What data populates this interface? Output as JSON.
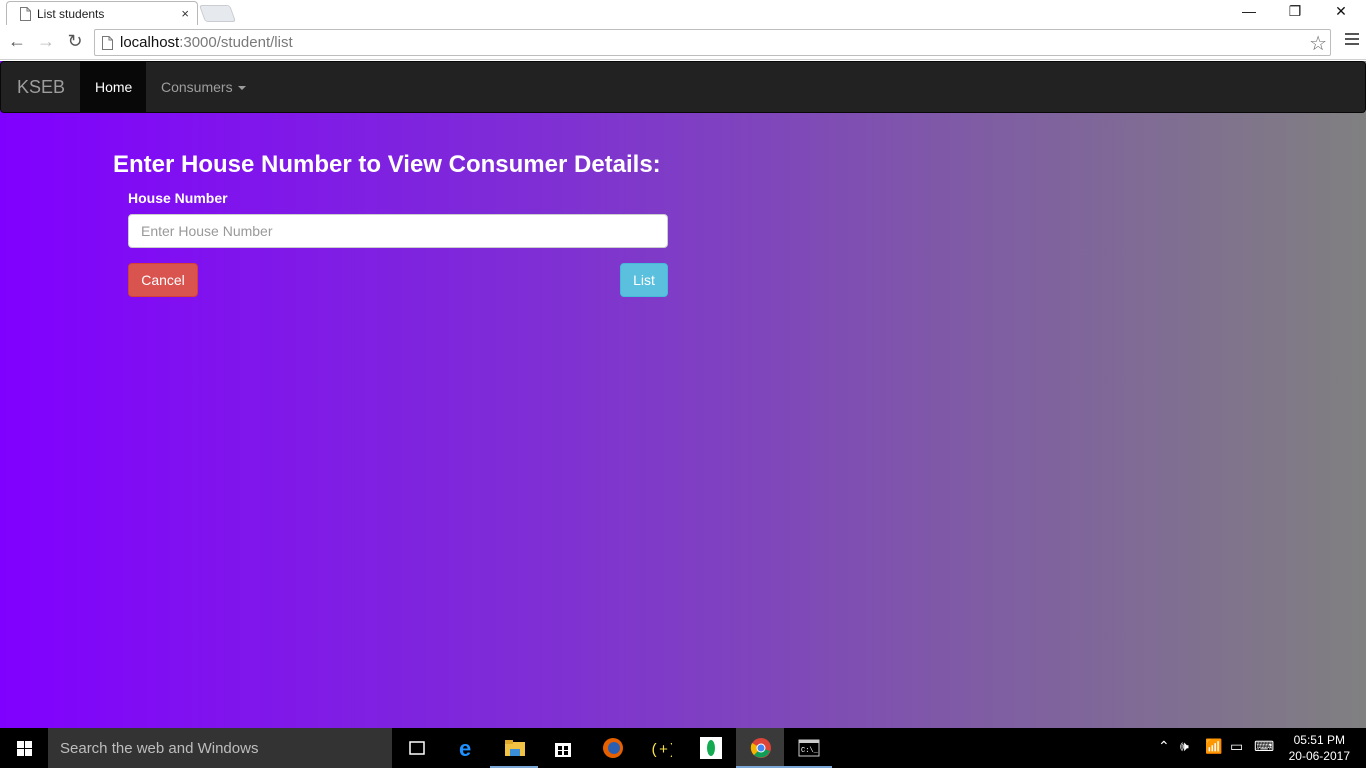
{
  "browser": {
    "tab_title": "List students",
    "tab_close": "×",
    "url_host": "localhost",
    "url_path": ":3000/student/list",
    "window_controls": [
      "—",
      "❐",
      "✕"
    ]
  },
  "navbar": {
    "brand": "KSEB",
    "items": [
      {
        "label": "Home",
        "active": true
      },
      {
        "label": "Consumers",
        "dropdown": true
      }
    ]
  },
  "form": {
    "heading": "Enter House Number to View Consumer Details:",
    "house_number_label": "House Number",
    "house_number_placeholder": "Enter House Number",
    "house_number_value": "",
    "cancel_label": "Cancel",
    "list_label": "List"
  },
  "colors": {
    "gradient_start": "#8000ff",
    "gradient_end": "#808080",
    "navbar_bg": "#222222",
    "cancel_bg": "#d9534f",
    "list_bg": "#5bc0de"
  },
  "taskbar": {
    "search_placeholder": "Search the web and Windows",
    "apps": [
      "task-view-icon",
      "edge-icon",
      "file-explorer-icon",
      "store-icon",
      "firefox-icon",
      "code-editor-icon",
      "mongodb-icon",
      "chrome-icon",
      "command-prompt-icon"
    ],
    "time": "05:51 PM",
    "date": "20-06-2017"
  }
}
